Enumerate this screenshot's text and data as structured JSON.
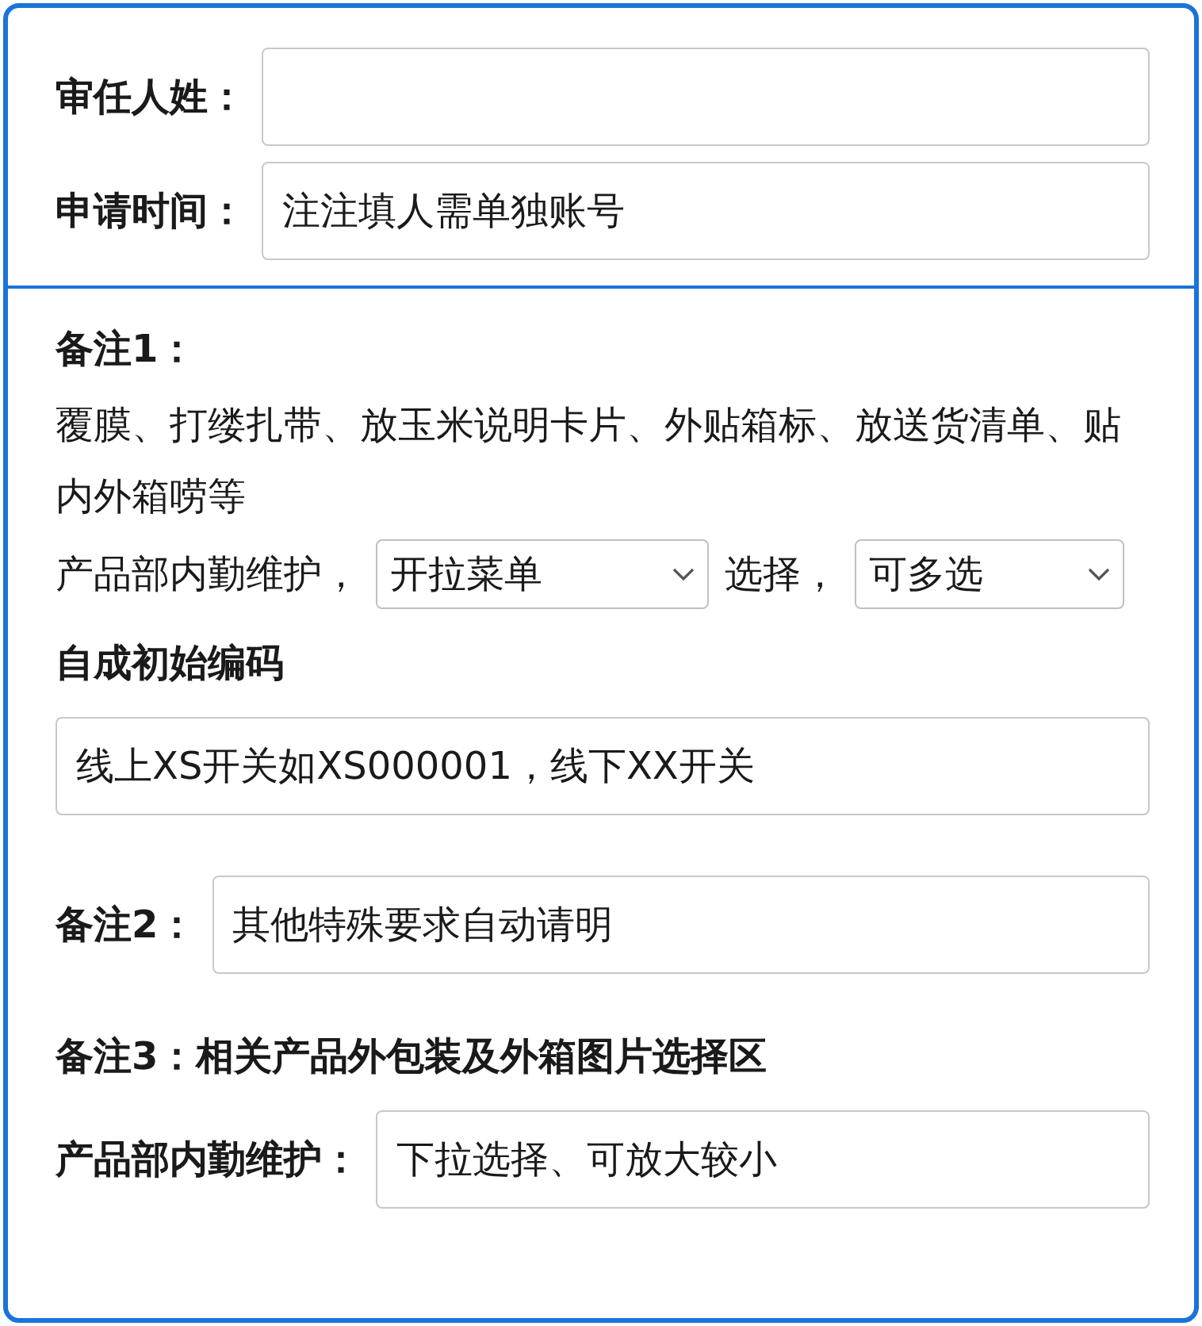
{
  "top_fields": [
    {
      "label": "审任人姓："
    },
    {
      "label": "申请时间：",
      "value": "注注填人需单独账号"
    }
  ],
  "note1": {
    "label": "备注1：",
    "text": "覆膜、打缕扎带、放玉米说明卡片、外贴箱标、放送货清单、贴内外箱唠等",
    "select_row": {
      "prefix": "产品部内勤维护，",
      "select_1": "开拉菜单",
      "middle": "选择，",
      "select_2": "可多选"
    }
  },
  "code_section": {
    "heading": "自成初始编码",
    "value": "线上XS开关如XS000001，线下XX开关"
  },
  "note2": {
    "label": "备注2：",
    "value": "其他特殊要求自动请明"
  },
  "note3": {
    "heading": "备注3：相关产品外包装及外箱图片选择区",
    "label": "产品部内勤维护：",
    "value": "下拉选择、可放大较小"
  }
}
